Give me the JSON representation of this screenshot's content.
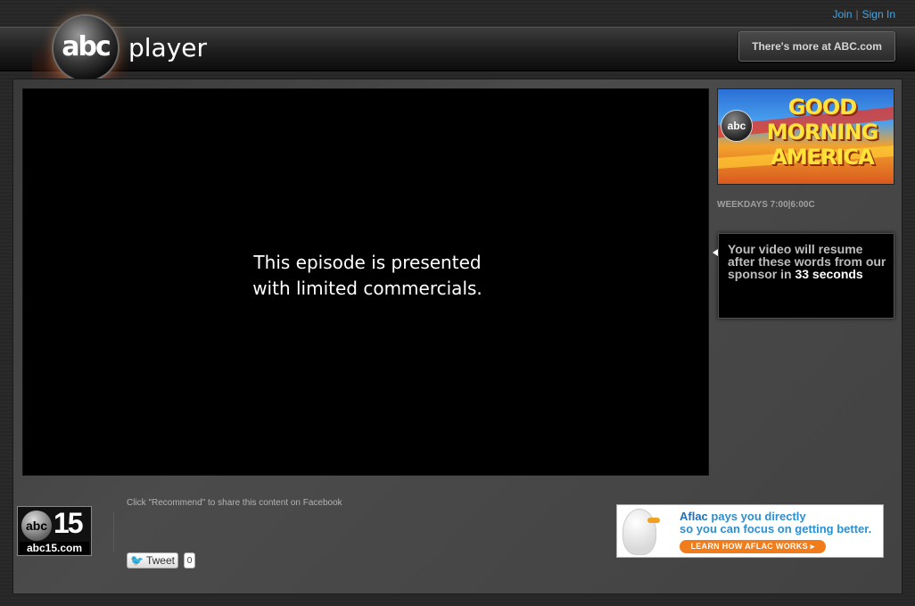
{
  "top_links": {
    "join": "Join",
    "separator": "|",
    "sign_in": "Sign In"
  },
  "header": {
    "logo_text": "abc",
    "product": "player",
    "more_button": "There's more at ABC.com"
  },
  "video": {
    "message_line1": "This episode is presented",
    "message_line2": "with limited commercials."
  },
  "sidebar": {
    "promo": {
      "logo": "abc",
      "title_line1": "GOOD",
      "title_line2": "MORNING",
      "title_line3": "AMERICA"
    },
    "schedule": "WEEKDAYS 7:00|6:00C",
    "resume": {
      "text": "Your video will resume after these words from our sponsor in",
      "seconds": "33",
      "unit": "seconds"
    }
  },
  "footer": {
    "station": {
      "logo_text": "abc",
      "number": "15",
      "url": "abc15.com"
    },
    "facebook_note": "Click \"Recommend\" to share this content on Facebook",
    "tweet": {
      "label": "Tweet",
      "count": "0"
    },
    "ad": {
      "brand": "Aflac",
      "line1_rest": " pays you directly",
      "line2": "so you can focus on getting better.",
      "cta": "LEARN HOW AFLAC WORKS ▸"
    }
  },
  "colors": {
    "link": "#4aa3df",
    "accent_orange": "#f07c1b",
    "video_bg": "#000000"
  }
}
